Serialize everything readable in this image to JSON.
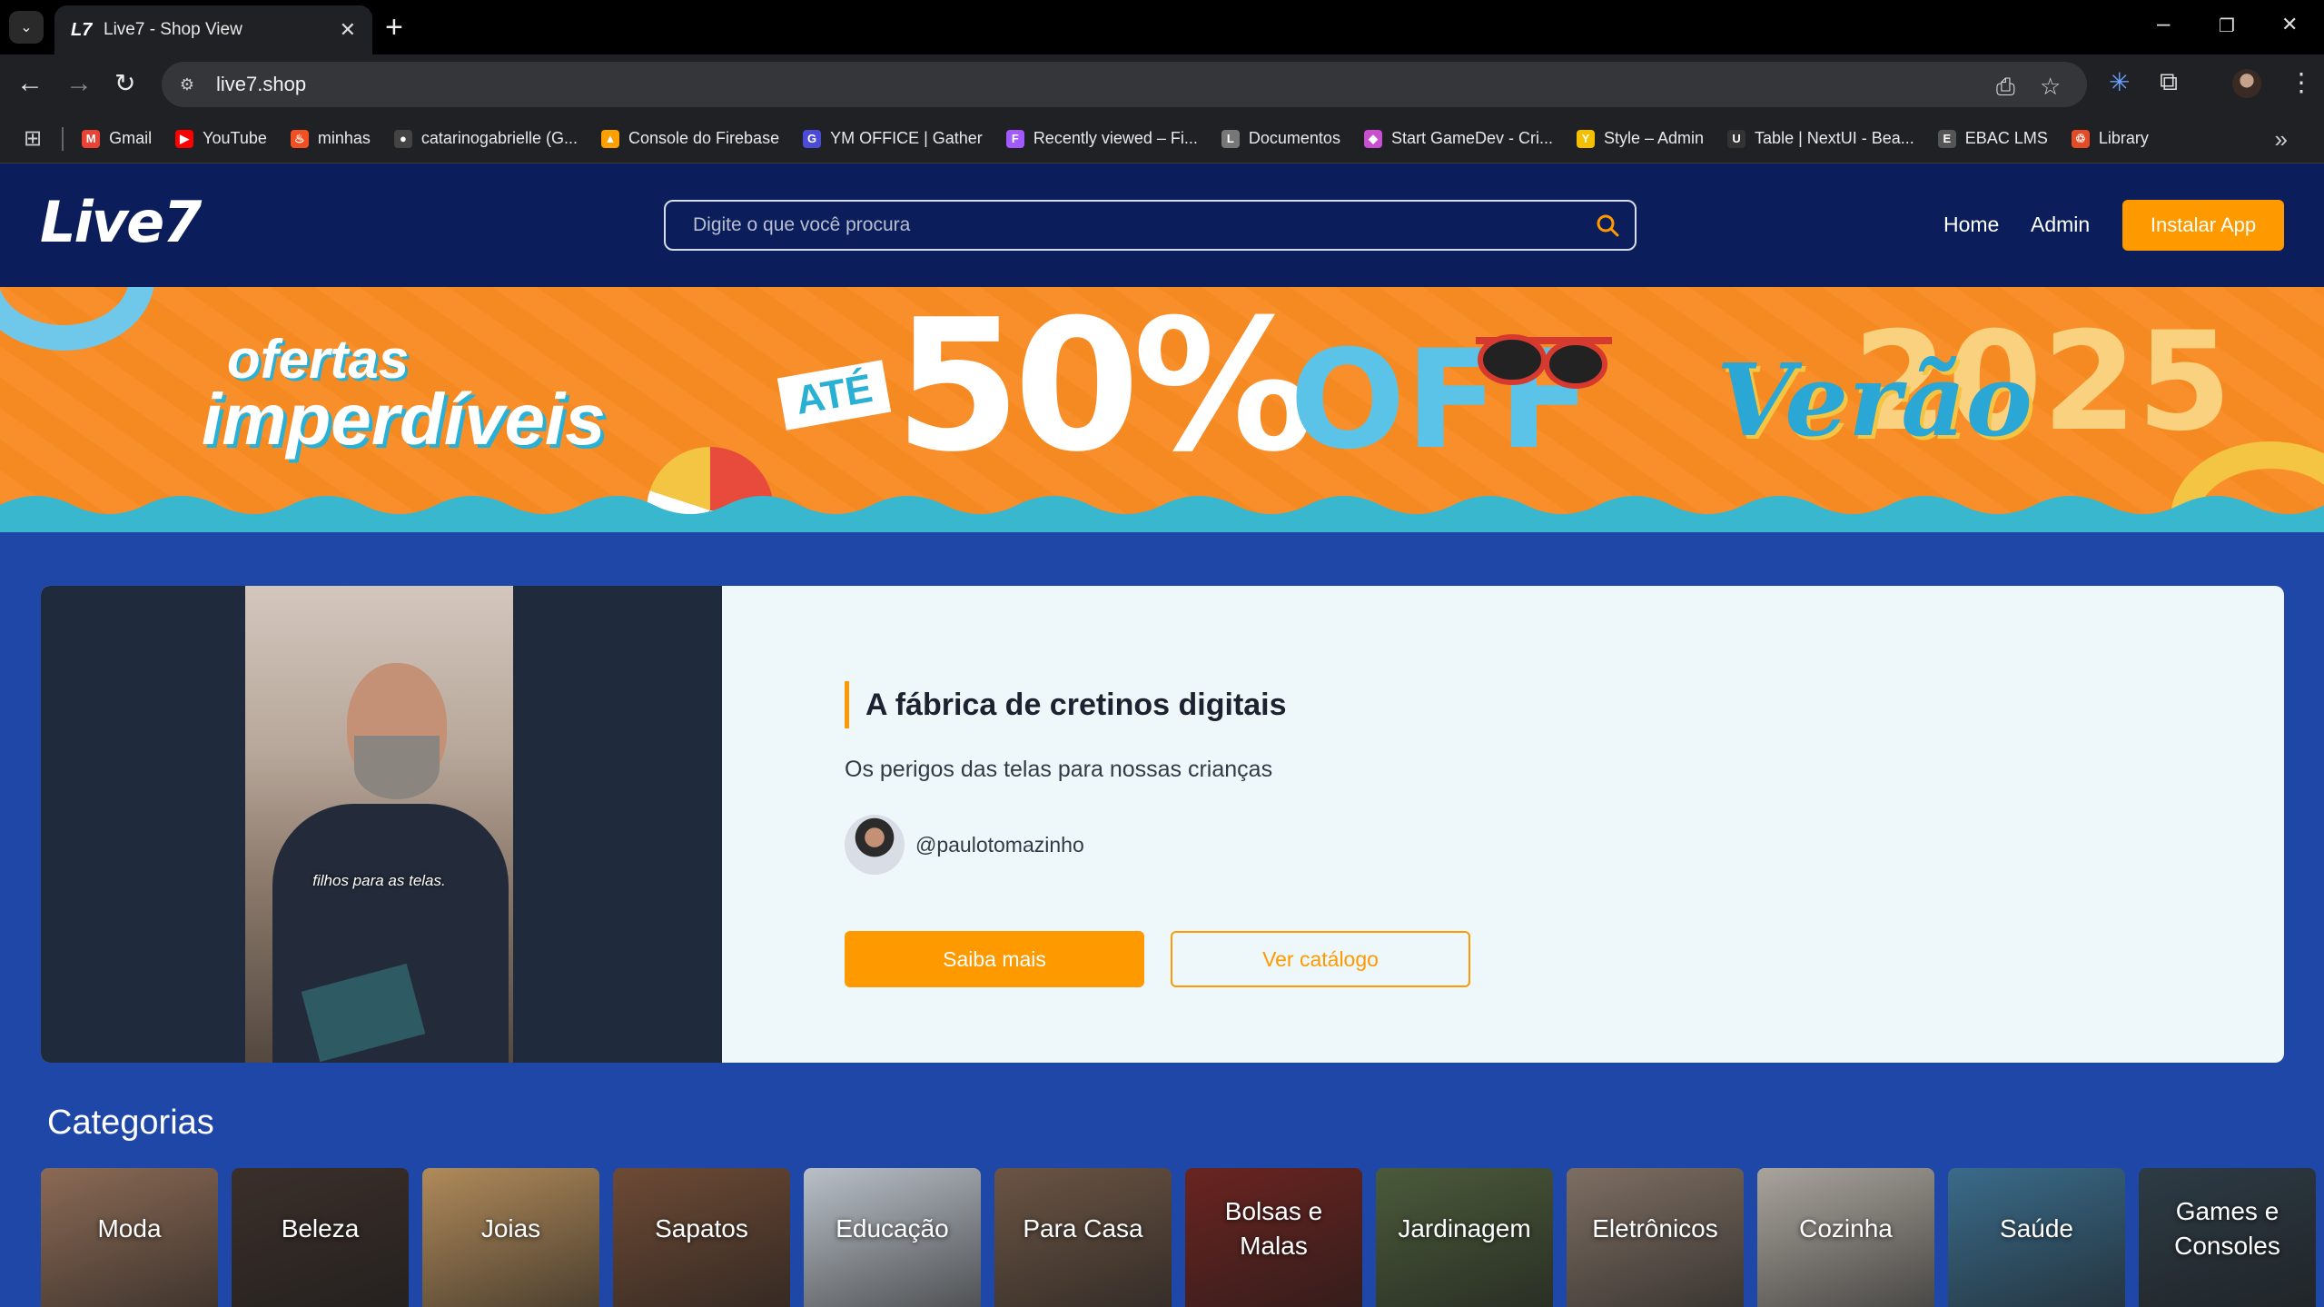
{
  "browser": {
    "tab_title": "Live7 - Shop View",
    "url": "live7.shop",
    "bookmarks": [
      {
        "label": "Gmail",
        "color": "#ea4335",
        "glyph": "M"
      },
      {
        "label": "YouTube",
        "color": "#ff0000",
        "glyph": "▶"
      },
      {
        "label": "minhas",
        "color": "#f25022",
        "glyph": "♨"
      },
      {
        "label": "catarinogabrielle (G...",
        "color": "#444",
        "glyph": "●"
      },
      {
        "label": "Console do Firebase",
        "color": "#ffa000",
        "glyph": "▲"
      },
      {
        "label": "YM OFFICE | Gather",
        "color": "#4b4bd6",
        "glyph": "G"
      },
      {
        "label": "Recently viewed – Fi...",
        "color": "#a259ff",
        "glyph": "F"
      },
      {
        "label": "Documentos",
        "color": "#777",
        "glyph": "L"
      },
      {
        "label": "Start GameDev - Cri...",
        "color": "#c94fd1",
        "glyph": "◆"
      },
      {
        "label": "Style – Admin",
        "color": "#f6c000",
        "glyph": "Y"
      },
      {
        "label": "Table | NextUI - Bea...",
        "color": "#333",
        "glyph": "U"
      },
      {
        "label": "EBAC LMS",
        "color": "#555",
        "glyph": "E"
      },
      {
        "label": "Library",
        "color": "#e34c26",
        "glyph": "♲"
      }
    ]
  },
  "header": {
    "logo": "Live7",
    "search_placeholder": "Digite o que você procura",
    "nav": {
      "home": "Home",
      "admin": "Admin"
    },
    "install_label": "Instalar App"
  },
  "banner": {
    "line1": "ofertas",
    "line2": "imperdíveis",
    "ate": "ATÉ",
    "percent": "50%",
    "off": "OFF",
    "verao": "Verão",
    "year": "2025"
  },
  "featured": {
    "video_caption": "filhos para as telas.",
    "title": "A fábrica de cretinos digitais",
    "subtitle": "Os perigos das telas para nossas crianças",
    "author": "@paulotomazinho",
    "primary_button": "Saiba mais",
    "secondary_button": "Ver catálogo"
  },
  "categories": {
    "heading": "Categorias",
    "items": [
      {
        "label": "Moda",
        "color": "#8b6a55"
      },
      {
        "label": "Beleza",
        "color": "#3b2f2a"
      },
      {
        "label": "Joias",
        "color": "#b08a5a"
      },
      {
        "label": "Sapatos",
        "color": "#6d4a35"
      },
      {
        "label": "Educação",
        "color": "#b9c0c8"
      },
      {
        "label": "Para Casa",
        "color": "#6b5444"
      },
      {
        "label": "Bolsas e Malas",
        "color": "#6a2420"
      },
      {
        "label": "Jardinagem",
        "color": "#4a5a3a"
      },
      {
        "label": "Eletrônicos",
        "color": "#7d6e62"
      },
      {
        "label": "Cozinha",
        "color": "#a9a49c"
      },
      {
        "label": "Saúde",
        "color": "#3a6b8a"
      },
      {
        "label": "Games e Consoles",
        "color": "#2d3b45"
      }
    ]
  }
}
